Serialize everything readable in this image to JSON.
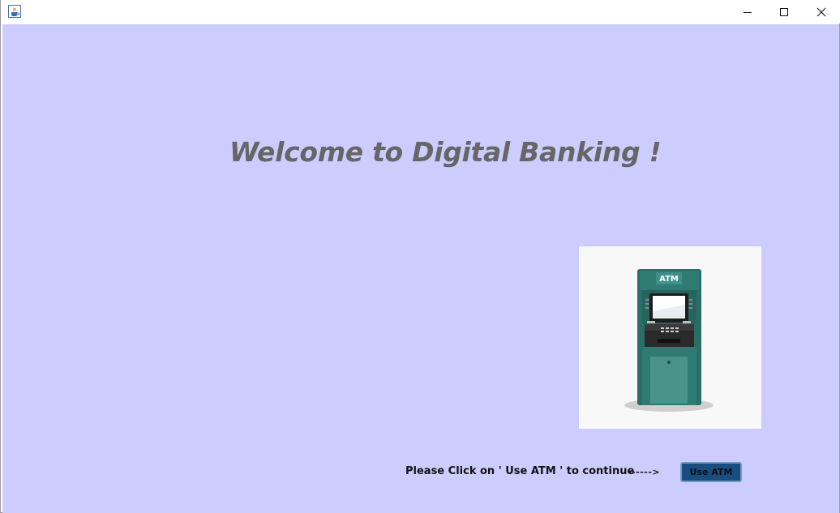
{
  "window": {
    "app_icon": "java-cup-icon",
    "controls": {
      "minimize_icon": "minimize-icon",
      "maximize_icon": "maximize-icon",
      "close_icon": "close-icon"
    }
  },
  "main": {
    "welcome_text": "Welcome to Digital Banking !",
    "atm_image": {
      "icon": "atm-machine-icon",
      "sign_text": "ATM"
    },
    "hint_text": "Please Click on ' Use ATM ' to continue",
    "arrow_text": "------>",
    "use_atm_button": "Use ATM"
  },
  "colors": {
    "background": "#ccccff",
    "welcome_text": "#666666",
    "button_fill": "#1a4e80",
    "button_border": "#6e9cc8",
    "atm_body": "#2b6e68"
  }
}
